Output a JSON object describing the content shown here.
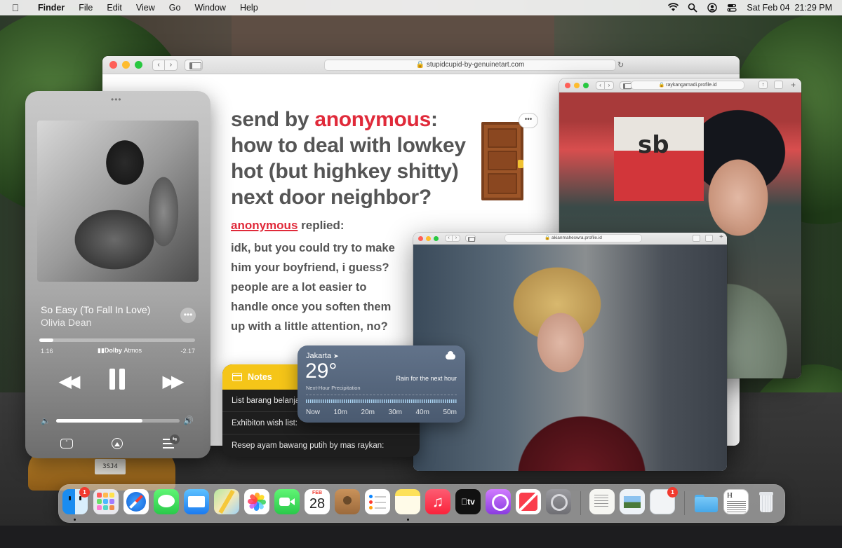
{
  "menubar": {
    "app": "Finder",
    "items": [
      "File",
      "Edit",
      "View",
      "Go",
      "Window",
      "Help"
    ],
    "clock": "Sat Feb 04  21:29 PM"
  },
  "safari_main": {
    "url": "stupidcupid-by-genuinetart.com",
    "post": {
      "prefix": "send by ",
      "author": "anonymous",
      "colon": ":",
      "question": "how to deal with lowkey hot (but highkey shitty) next door neighbor?",
      "reply_author": "anonymous",
      "reply_label": " replied:",
      "reply": "idk, but you could try to make him your boyfriend, i guess? people are a lot easier to handle once you soften them up with a little attention, no?",
      "bubble": "•••"
    }
  },
  "safari_rayk": {
    "url": "raykangamadi.profile.id",
    "sign": "sb"
  },
  "safari_akian": {
    "url": "akianmaheswra.profile.id"
  },
  "music": {
    "song": "So Easy (To Fall In Love)",
    "artist": "Olivia Dean",
    "elapsed": "1.16",
    "remaining": "-2.17",
    "dolby": "Dolby",
    "dolby_sub": "Atmos",
    "progress": 0.09,
    "volume": 0.7,
    "more": "•••"
  },
  "notes": {
    "title": "Notes",
    "items": [
      "List barang belanja",
      "Exhibiton wish list:",
      "Resep ayam bawang putih by mas raykan:"
    ]
  },
  "weather": {
    "city": "Jakarta",
    "temp": "29°",
    "desc": "Rain for the next hour",
    "sub": "Next-Hour Precipitation",
    "times": [
      "Now",
      "10m",
      "20m",
      "30m",
      "40m",
      "50m"
    ]
  },
  "dock": {
    "finder_badge": "1",
    "calendar_month": "FEB",
    "calendar_day": "28",
    "tv_label": "tv",
    "blank_badge": "1"
  },
  "wallpaper": {
    "plate": "3SJ4"
  },
  "colors": {
    "accent_red": "#e02a3a",
    "notes_yellow": "#f5c518",
    "weather_blue": "#5a6a80"
  }
}
